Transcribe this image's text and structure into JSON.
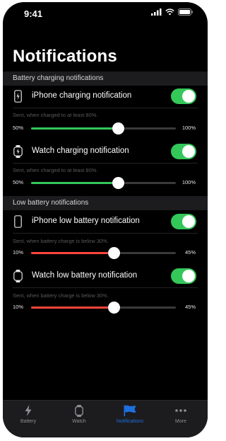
{
  "status_bar": {
    "time": "9:41"
  },
  "page": {
    "title": "Notifications"
  },
  "sections": [
    {
      "header": "Battery charging notifications",
      "items": [
        {
          "icon": "iphone-battery-icon",
          "label": "iPhone charging notification",
          "enabled": true,
          "hint": "Sent, when charged to at least 80%.",
          "min_label": "50%",
          "max_label": "100%",
          "value_fraction": 0.6,
          "fill_color": "#34c759"
        },
        {
          "icon": "watch-battery-icon",
          "label": "Watch charging notification",
          "enabled": true,
          "hint": "Sent, when charged to at least 80%.",
          "min_label": "50%",
          "max_label": "100%",
          "value_fraction": 0.6,
          "fill_color": "#34c759"
        }
      ]
    },
    {
      "header": "Low battery notifications",
      "items": [
        {
          "icon": "iphone-outline-icon",
          "label": "iPhone low battery notification",
          "enabled": true,
          "hint": "Sent, when battery charge is below 30%.",
          "min_label": "10%",
          "max_label": "45%",
          "value_fraction": 0.57,
          "fill_color": "#ff453a"
        },
        {
          "icon": "watch-outline-icon",
          "label": "Watch low battery notification",
          "enabled": true,
          "hint": "Sent, when battery charge is below 30%.",
          "min_label": "10%",
          "max_label": "45%",
          "value_fraction": 0.57,
          "fill_color": "#ff453a"
        }
      ]
    }
  ],
  "tabbar": {
    "tabs": [
      {
        "label": "Battery",
        "icon": "bolt-icon",
        "active": false
      },
      {
        "label": "Watch",
        "icon": "watch-icon",
        "active": false
      },
      {
        "label": "Notifications",
        "icon": "flag-icon",
        "active": true
      },
      {
        "label": "More",
        "icon": "more-dots-icon",
        "active": false
      }
    ]
  },
  "colors": {
    "accent": "#1e6fe0",
    "toggle_on": "#34c759",
    "charge_fill": "#34c759",
    "low_fill": "#ff453a"
  }
}
